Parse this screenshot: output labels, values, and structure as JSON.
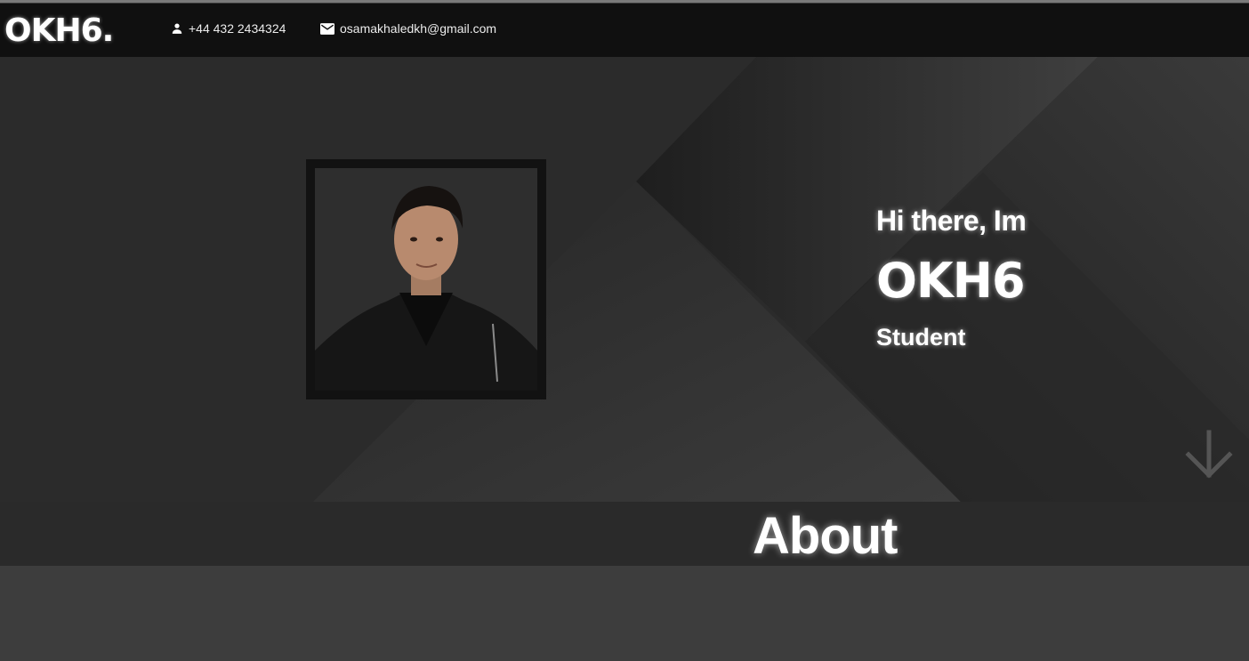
{
  "header": {
    "logo": "OKH6.",
    "phone": {
      "icon": "person-icon",
      "text": "+44 432 2434324"
    },
    "email": {
      "icon": "mail-icon",
      "text": "osamakhaledkh@gmail.com"
    }
  },
  "hero": {
    "greeting": "Hi there, Im",
    "name": "OKH6",
    "role": "Student",
    "scroll_icon": "arrow-down-icon"
  },
  "about": {
    "title": "About"
  },
  "colors": {
    "navbar": "#101010",
    "hero_bg": "#2b2b2b",
    "text": "#ffffff",
    "frame": "#121212"
  }
}
